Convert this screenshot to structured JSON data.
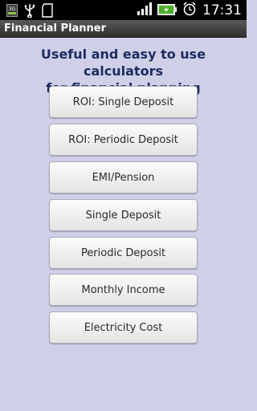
{
  "status_bar": {
    "time": "17:31",
    "network_label": "3G"
  },
  "app": {
    "title": "Financial Planner"
  },
  "main": {
    "headline_line1": "Useful and easy to use calculators",
    "headline_line2": "for financial planning",
    "buttons": [
      {
        "label": "ROI: Single Deposit"
      },
      {
        "label": "ROI: Periodic Deposit"
      },
      {
        "label": "EMI/Pension"
      },
      {
        "label": "Single Deposit"
      },
      {
        "label": "Periodic Deposit"
      },
      {
        "label": "Monthly Income"
      },
      {
        "label": "Electricity Cost"
      }
    ]
  },
  "colors": {
    "background": "#cfcfe8",
    "headline": "#1c2c5e",
    "battery": "#4caf2a"
  }
}
